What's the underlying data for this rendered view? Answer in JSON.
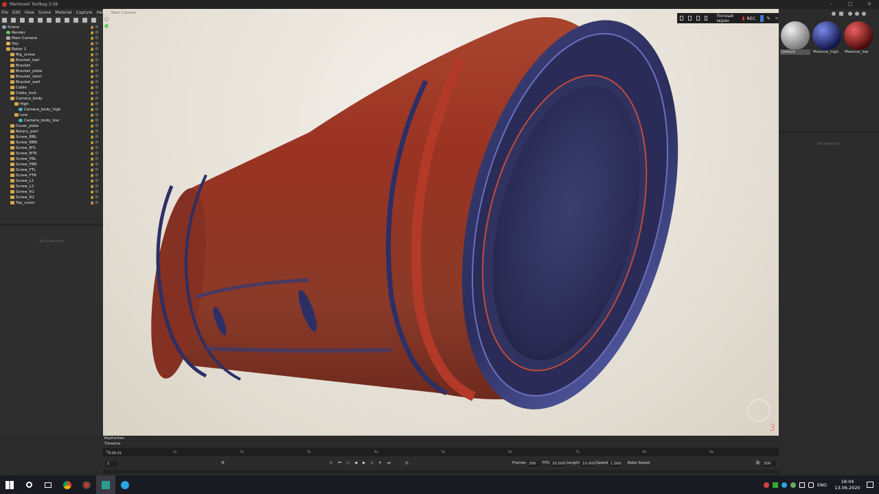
{
  "window": {
    "title": "Marmoset Toolbag 3.08"
  },
  "menu": [
    "File",
    "Edit",
    "View",
    "Scene",
    "Material",
    "Capture",
    "Help"
  ],
  "outliner": {
    "items": [
      {
        "label": "Scene",
        "depth": 0,
        "icon": "scene-icon"
      },
      {
        "label": "Render",
        "depth": 1,
        "icon": "render-icon"
      },
      {
        "label": "Main Camera",
        "depth": 1,
        "icon": "camera-icon"
      },
      {
        "label": "Sky",
        "depth": 1,
        "icon": "sky-icon"
      },
      {
        "label": "Baker 1",
        "depth": 1,
        "icon": "folder-icon"
      },
      {
        "label": "Big_screw",
        "depth": 2,
        "icon": "folder-icon"
      },
      {
        "label": "Bracket_ball",
        "depth": 2,
        "icon": "folder-icon"
      },
      {
        "label": "Bracket",
        "depth": 2,
        "icon": "folder-icon"
      },
      {
        "label": "Bracket_plate",
        "depth": 2,
        "icon": "folder-icon"
      },
      {
        "label": "Bracket_twist",
        "depth": 2,
        "icon": "folder-icon"
      },
      {
        "label": "Bracket_wall",
        "depth": 2,
        "icon": "folder-icon"
      },
      {
        "label": "Cable",
        "depth": 2,
        "icon": "folder-icon"
      },
      {
        "label": "Cable_lock",
        "depth": 2,
        "icon": "folder-icon"
      },
      {
        "label": "Camera_body",
        "depth": 2,
        "icon": "folder-icon"
      },
      {
        "label": "High",
        "depth": 3,
        "icon": "folder-icon"
      },
      {
        "label": "Camera_body_high",
        "depth": 4,
        "icon": "mesh-icon"
      },
      {
        "label": "Low",
        "depth": 3,
        "icon": "folder-icon"
      },
      {
        "label": "Camera_body_low",
        "depth": 4,
        "icon": "mesh-icon"
      },
      {
        "label": "Cover_plate",
        "depth": 2,
        "icon": "folder-icon"
      },
      {
        "label": "Rotary_part",
        "depth": 2,
        "icon": "folder-icon"
      },
      {
        "label": "Screw_BBL",
        "depth": 2,
        "icon": "folder-icon"
      },
      {
        "label": "Screw_BBR",
        "depth": 2,
        "icon": "folder-icon"
      },
      {
        "label": "Screw_BTL",
        "depth": 2,
        "icon": "folder-icon"
      },
      {
        "label": "Screw_BTR",
        "depth": 2,
        "icon": "folder-icon"
      },
      {
        "label": "Screw_FBL",
        "depth": 2,
        "icon": "folder-icon"
      },
      {
        "label": "Screw_FBR",
        "depth": 2,
        "icon": "folder-icon"
      },
      {
        "label": "Screw_FTL",
        "depth": 2,
        "icon": "folder-icon"
      },
      {
        "label": "Screw_FTR",
        "depth": 2,
        "icon": "folder-icon"
      },
      {
        "label": "Screw_L1",
        "depth": 2,
        "icon": "folder-icon"
      },
      {
        "label": "Screw_L2",
        "depth": 2,
        "icon": "folder-icon"
      },
      {
        "label": "Screw_R1",
        "depth": 2,
        "icon": "folder-icon"
      },
      {
        "label": "Screw_R2",
        "depth": 2,
        "icon": "folder-icon"
      },
      {
        "label": "Top_cover",
        "depth": 2,
        "icon": "folder-icon"
      }
    ]
  },
  "properties": {
    "empty_text": "No Selection"
  },
  "viewport": {
    "camera_label": "Main Camera"
  },
  "recorder": {
    "fullscreen_label": "Полный экран",
    "rec_label": "REC"
  },
  "materials": {
    "items": [
      {
        "name": "Default",
        "color": "#bdbdbd"
      },
      {
        "name": "Material_high",
        "color": "#2a3a9a"
      },
      {
        "name": "Material_low",
        "color": "#a01818"
      }
    ],
    "empty_text": "No Selection"
  },
  "timeline": {
    "keyframes_label": "Keyframes",
    "timeline_label": "Timeline",
    "current_time": "0:00.01",
    "ticks": [
      "0s",
      "1s",
      "2s",
      "3s",
      "4s",
      "5s",
      "6s",
      "7s",
      "8s",
      "9s"
    ],
    "frame_field": "1",
    "frames_label": "Frames",
    "frames_value": "300",
    "fps_label": "FPS",
    "fps_value": "30.000",
    "length_label": "Length",
    "length_value": "10.000",
    "speed_label": "Speed",
    "speed_value": "1.000",
    "bake_speed_label": "Bake Speed",
    "end_frame": "300"
  },
  "taskbar": {
    "time": "18:04",
    "date": "13.06.2020",
    "lang": "ENG"
  }
}
